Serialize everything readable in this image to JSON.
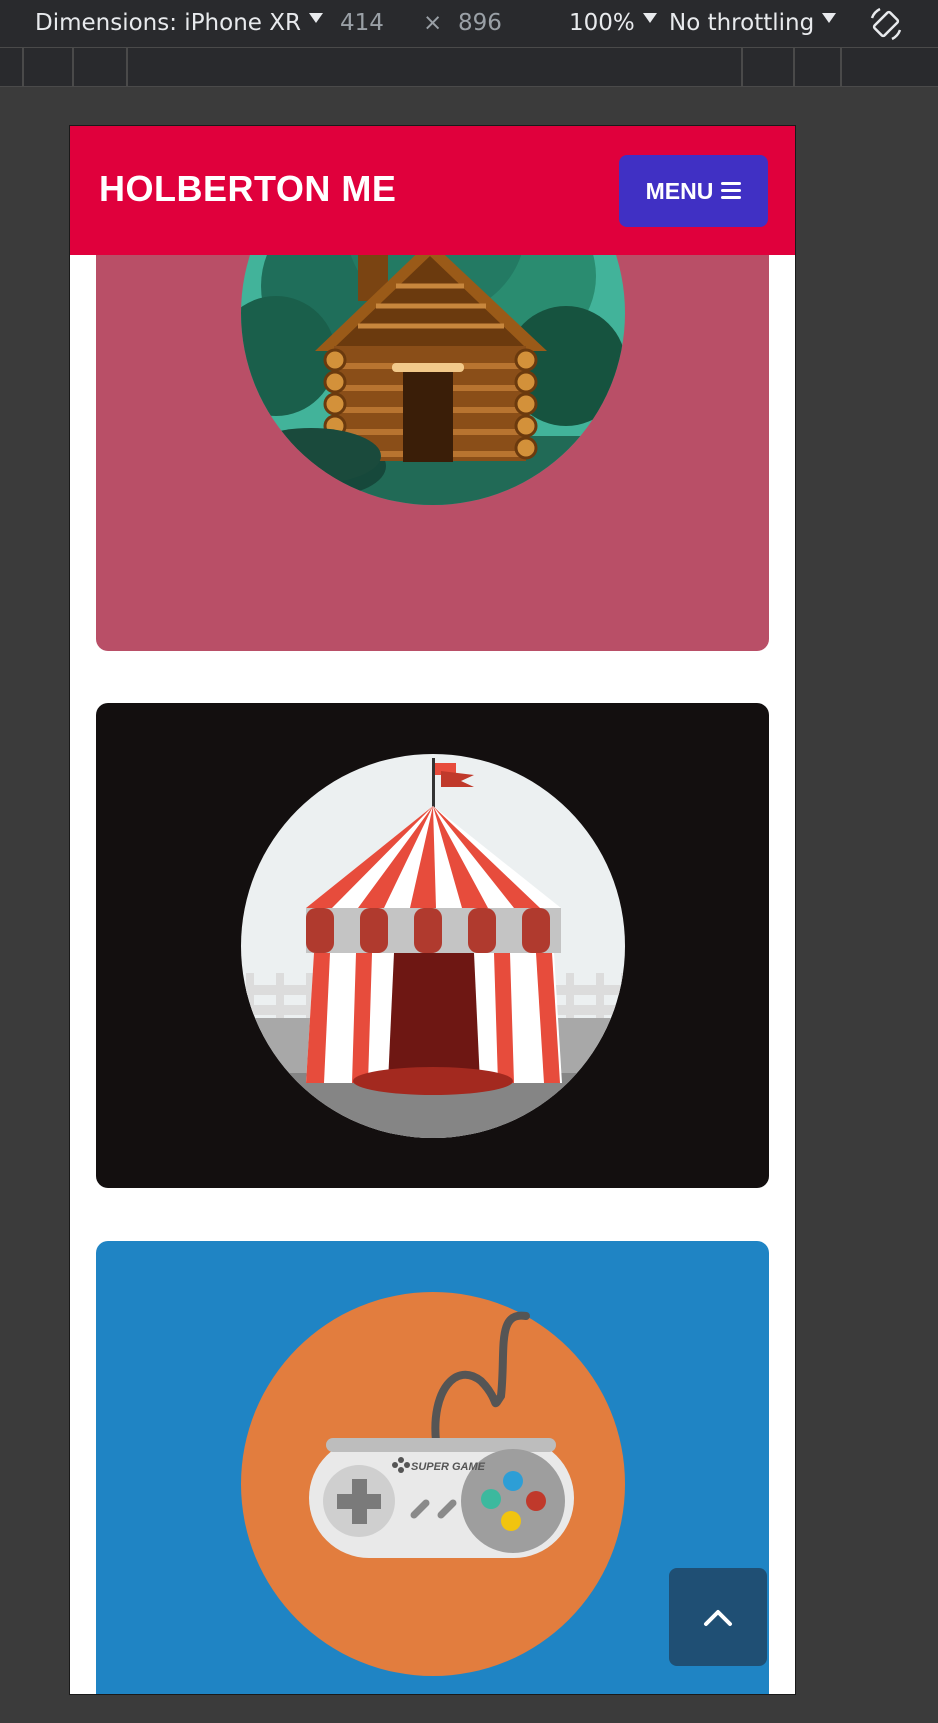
{
  "devtools": {
    "device_label": "Dimensions: iPhone XR",
    "width": "414",
    "times": "×",
    "height": "896",
    "zoom": "100%",
    "throttling": "No throttling"
  },
  "site": {
    "logo": "HOLBERTON ME",
    "menu_label": "MENU",
    "header_color": "#e0003c",
    "menu_color": "#4030c4"
  },
  "cards": [
    {
      "image": "log-cabin-illustration",
      "background": "#b94f67"
    },
    {
      "image": "circus-tent-illustration",
      "background": "#130f0f"
    },
    {
      "image": "game-controller-illustration",
      "background": "#1f84c4",
      "label": "SUPER GAME"
    }
  ],
  "scroll_top_icon": "chevron-up-icon"
}
